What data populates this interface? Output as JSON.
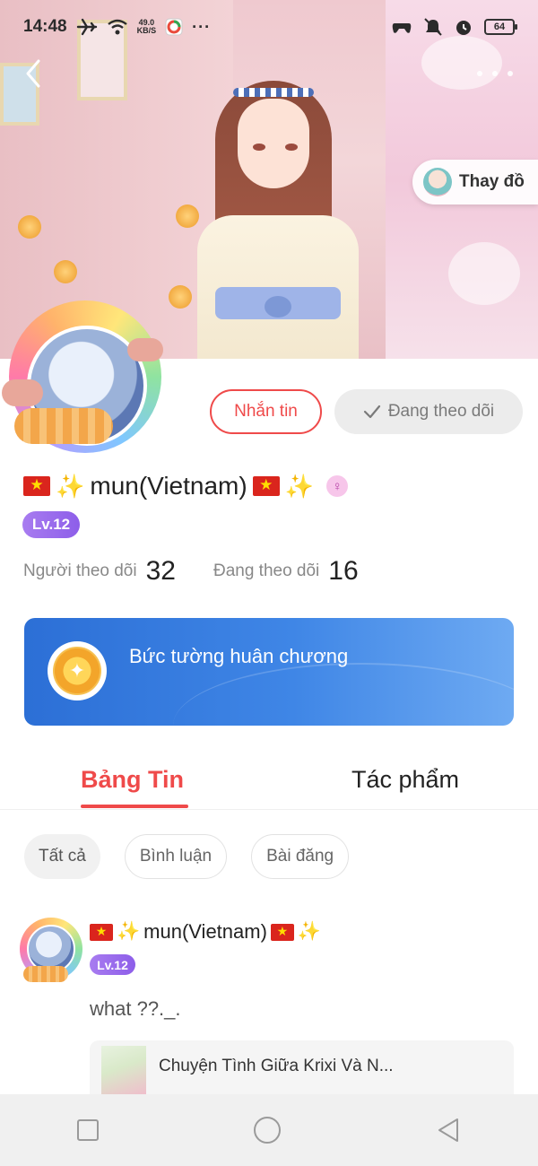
{
  "status_bar": {
    "time": "14:48",
    "net_speed_value": "49.0",
    "net_speed_unit": "KB/S",
    "battery": "64"
  },
  "header": {
    "change_outfit_label": "Thay đồ"
  },
  "profile": {
    "message_button": "Nhắn tin",
    "follow_button": "Đang theo dõi",
    "username": "mun(Vietnam)",
    "level": "Lv.12",
    "followers_label": "Người theo dõi",
    "followers_count": "32",
    "following_label": "Đang theo dõi",
    "following_count": "16"
  },
  "medal_wall": {
    "title": "Bức tường huân chương"
  },
  "tabs": [
    {
      "label": "Bảng Tin",
      "active": true
    },
    {
      "label": "Tác phẩm",
      "active": false
    }
  ],
  "filters": [
    {
      "label": "Tất cả",
      "selected": true
    },
    {
      "label": "Bình luận",
      "selected": false
    },
    {
      "label": "Bài đăng",
      "selected": false
    }
  ],
  "post": {
    "username": "mun(Vietnam)",
    "level": "Lv.12",
    "text": "what ??._.",
    "work_title": "Chuyện Tình Giữa Krixi Và N..."
  },
  "colors": {
    "accent": "#ef4a4a",
    "level_badge": "#8d5ee9",
    "medal_banner": "#3f86e6"
  }
}
